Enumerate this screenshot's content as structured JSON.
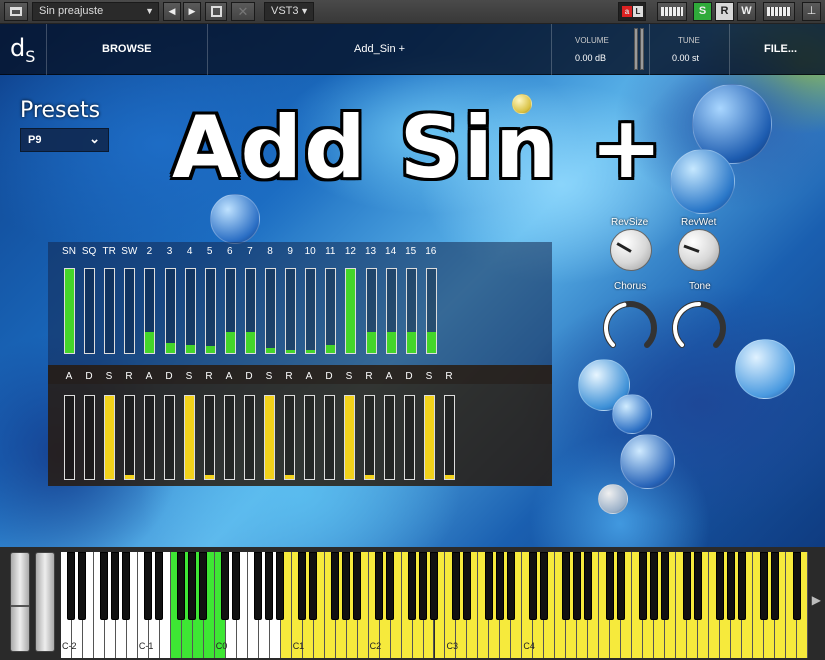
{
  "host": {
    "preset_combo": "Sin preajuste",
    "format_combo": "VST3",
    "btn_s": "S",
    "btn_r": "R",
    "btn_w": "W",
    "colors": {
      "bar_bg": "#3e3e3e",
      "s_green": "#2faa3a",
      "a_red": "#d22"
    }
  },
  "plugin": {
    "logo_d": "d",
    "logo_s": "S",
    "nav_browse": "BROWSE",
    "instrument_name": "Add_Sin +",
    "volume_label": "VOLUME",
    "volume_value": "0.00 dB",
    "tune_label": "TUNE",
    "tune_value": "0.00 st",
    "nav_file": "FILE...",
    "presets_label": "Presets",
    "preset_value": "P9",
    "title": "Add Sin +"
  },
  "harmonics": {
    "labels": [
      "SN",
      "SQ",
      "TR",
      "SW",
      "2",
      "3",
      "4",
      "5",
      "6",
      "7",
      "8",
      "9",
      "10",
      "11",
      "12",
      "13",
      "14",
      "15",
      "16"
    ],
    "levels": [
      1.0,
      0,
      0,
      0,
      0.25,
      0.12,
      0.1,
      0.08,
      0.25,
      0.25,
      0.06,
      0.04,
      0.04,
      0.1,
      1.0,
      0.25,
      0.25,
      0.25,
      0.25
    ],
    "color": "#44d62a"
  },
  "envelopes": {
    "labels": [
      "A",
      "D",
      "S",
      "R",
      "A",
      "D",
      "S",
      "R",
      "A",
      "D",
      "S",
      "R",
      "A",
      "D",
      "S",
      "R",
      "A",
      "D",
      "S",
      "R"
    ],
    "levels": [
      0,
      0,
      1.0,
      0.05,
      0,
      0,
      1.0,
      0.05,
      0,
      0,
      1.0,
      0.05,
      0,
      0,
      1.0,
      0.05,
      0,
      0,
      1.0,
      0.05
    ],
    "color": "#f2d21b"
  },
  "knobs": {
    "revsize_label": "RevSize",
    "revwet_label": "RevWet",
    "chorus_label": "Chorus",
    "tone_label": "Tone",
    "chorus_value": 0.45,
    "tone_value": 0.5
  },
  "keyboard": {
    "octave_labels": [
      "C-2",
      "C-1",
      "C0",
      "C1",
      "C2",
      "C3",
      "C4"
    ],
    "white_key_count": 68,
    "green_range": [
      10,
      14
    ],
    "yellow_from": 20,
    "colors": {
      "white": "#ffffff",
      "green": "#3ee634",
      "yellow": "#f6ea3c"
    }
  }
}
